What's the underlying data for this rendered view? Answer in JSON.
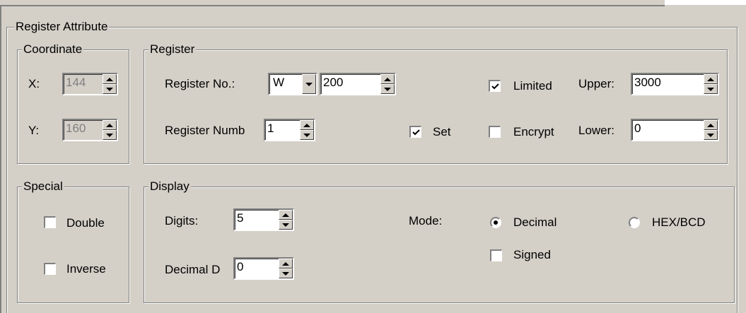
{
  "attribute": {
    "title": "Register Attribute"
  },
  "coordinate": {
    "title": "Coordinate",
    "x_label": "X:",
    "x_value": "144",
    "y_label": "Y:",
    "y_value": "160"
  },
  "register": {
    "title": "Register",
    "no_label": "Register No.:",
    "type_value": "W",
    "no_value": "200",
    "number_label": "Register Numb",
    "number_value": "1",
    "set_label": "Set",
    "set_checked": true,
    "limited_label": "Limited",
    "limited_checked": true,
    "encrypt_label": "Encrypt",
    "encrypt_checked": false,
    "upper_label": "Upper:",
    "upper_value": "3000",
    "lower_label": "Lower:",
    "lower_value": "0"
  },
  "special": {
    "title": "Special",
    "double_label": "Double",
    "double_checked": false,
    "inverse_label": "Inverse",
    "inverse_checked": false
  },
  "display": {
    "title": "Display",
    "digits_label": "Digits:",
    "digits_value": "5",
    "decimal_label": "Decimal D",
    "decimal_value": "0",
    "mode_label": "Mode:",
    "decimal_mode_label": "Decimal",
    "decimal_mode_selected": true,
    "hex_mode_label": "HEX/BCD",
    "hex_mode_selected": false,
    "signed_label": "Signed",
    "signed_checked": false
  }
}
